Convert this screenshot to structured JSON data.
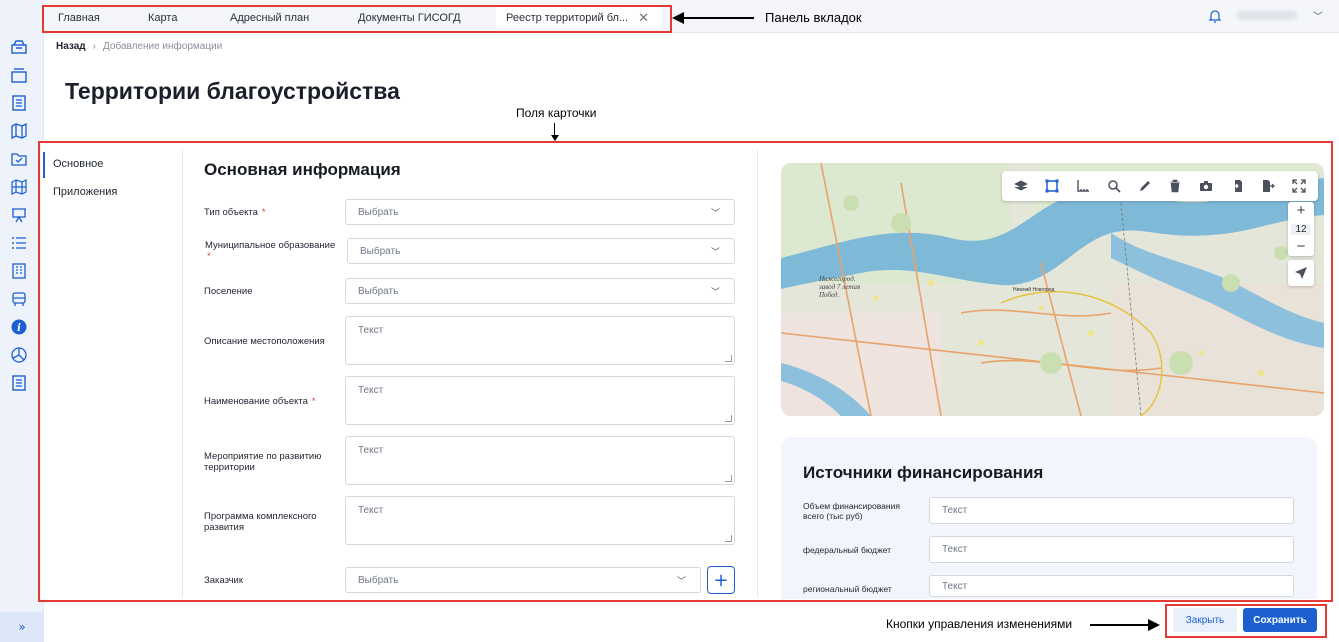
{
  "tabs": [
    {
      "label": "Главная"
    },
    {
      "label": "Карта"
    },
    {
      "label": "Адресный план"
    },
    {
      "label": "Документы ГИСОГД"
    },
    {
      "label": "Реестр территорий бл...",
      "active": true
    }
  ],
  "annotations": {
    "tabs_panel": "Панель вкладок",
    "card_fields": "Поля карточки",
    "change_buttons": "Кнопки управления изменениями"
  },
  "breadcrumb": {
    "back": "Назад",
    "current": "Добавление информации"
  },
  "page_title": "Территории благоустройства",
  "side_nav": {
    "items": [
      "Основное",
      "Приложения"
    ],
    "active_index": 0
  },
  "form": {
    "title": "Основная информация",
    "fields": [
      {
        "label": "Тип объекта",
        "required": true,
        "kind": "select",
        "placeholder": "Выбрать"
      },
      {
        "label": "Муниципальное образование",
        "required": true,
        "kind": "select",
        "placeholder": "Выбрать"
      },
      {
        "label": "Поселение",
        "required": false,
        "kind": "select",
        "placeholder": "Выбрать"
      },
      {
        "label": "Описание местоположения",
        "required": false,
        "kind": "text",
        "placeholder": "Текст"
      },
      {
        "label": "Наименование объекта",
        "required": true,
        "kind": "text",
        "placeholder": "Текст"
      },
      {
        "label": "Мероприятие по развитию территории",
        "required": false,
        "kind": "text",
        "placeholder": "Текст"
      },
      {
        "label": "Программа комплексного развития",
        "required": false,
        "kind": "text",
        "placeholder": "Текст"
      },
      {
        "label": "Заказчик",
        "required": false,
        "kind": "select",
        "placeholder": "Выбрать"
      }
    ],
    "required_mark": "*",
    "add_label": "+"
  },
  "map": {
    "zoom_in": "+",
    "zoom_level": "12",
    "zoom_out": "−",
    "toolbar_icons": [
      "layers-icon",
      "select-area-icon",
      "ruler-icon",
      "search-icon",
      "pencil-icon",
      "trash-icon",
      "camera-icon",
      "import-icon",
      "export-icon",
      "fullscreen-icon"
    ],
    "place_labels": {
      "plant": "Нижегород. завод 7 летия Побед.",
      "city": "Нижний Новгород"
    }
  },
  "financing": {
    "title": "Источники финансирования",
    "fields": [
      {
        "label": "Объем финансирования всего (тыс руб)",
        "placeholder": "Текст"
      },
      {
        "label": "федеральный бюджет",
        "placeholder": "Текст"
      },
      {
        "label": "региональный бюджет",
        "placeholder": "Текст"
      }
    ]
  },
  "actions": {
    "close": "Закрыть",
    "save": "Сохранить"
  },
  "rail": {
    "expand": "»"
  },
  "colors": {
    "accent": "#1b5fd1",
    "annotation_red": "#e53935",
    "rail_bg": "#eef3fb"
  }
}
